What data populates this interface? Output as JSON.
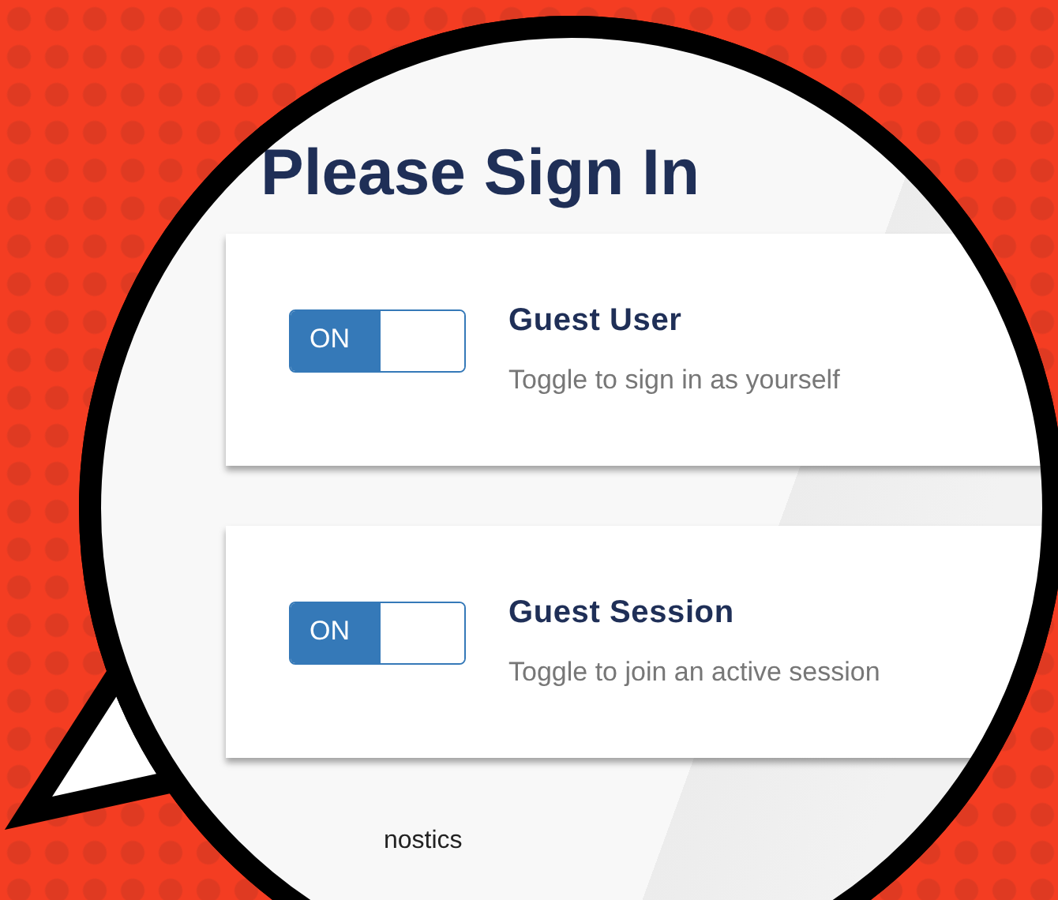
{
  "title": "Please Sign In",
  "options": [
    {
      "name": "Guest User",
      "description": "Toggle to sign in as yourself",
      "on": true,
      "state_label": "ON"
    },
    {
      "name": "Guest Session",
      "description": "Toggle to join an active session",
      "on": true,
      "state_label": "ON"
    }
  ],
  "footer_text": "nostics"
}
